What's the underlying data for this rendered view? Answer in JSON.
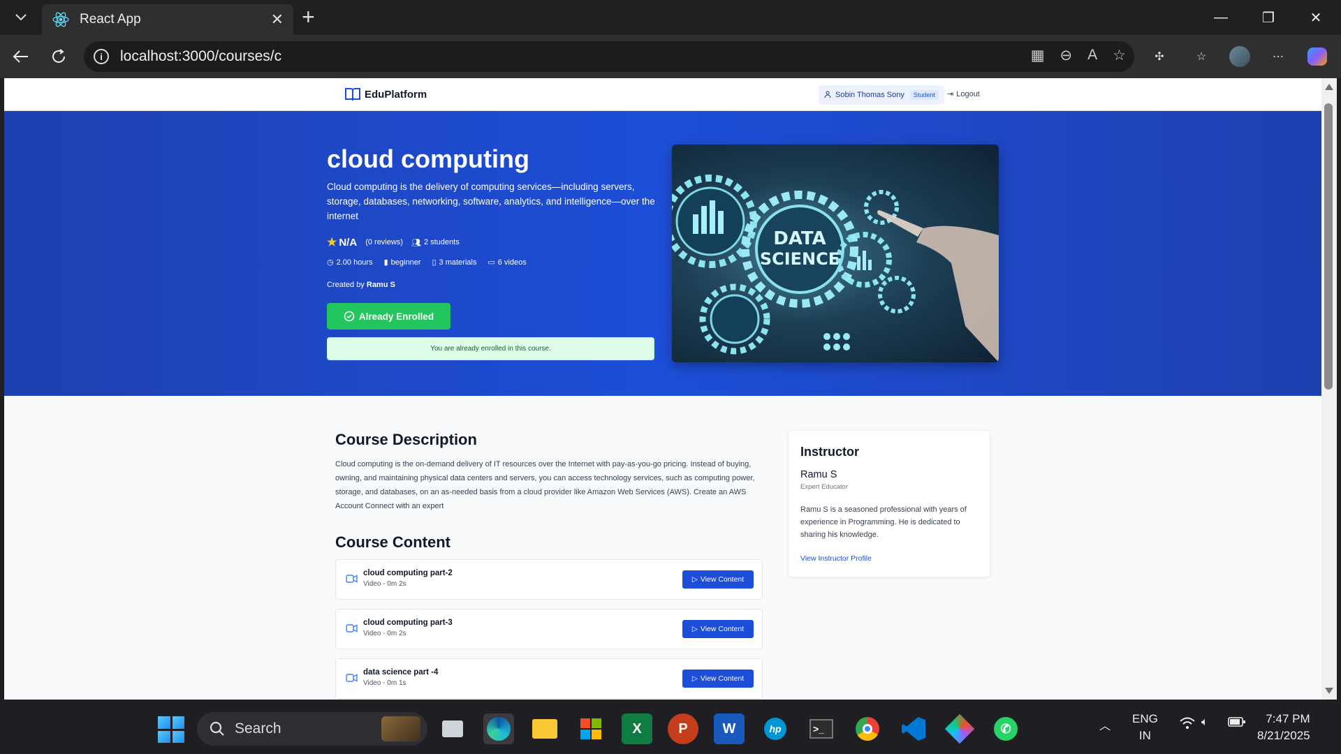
{
  "browser": {
    "tab_title": "React App",
    "url": "localhost:3000/courses/c"
  },
  "site": {
    "logo": "EduPlatform",
    "user_name": "Sobin Thomas Sony",
    "user_role": "Student",
    "logout": "Logout"
  },
  "course": {
    "title": "cloud computing",
    "short_description": "Cloud computing is the delivery of computing services—including servers, storage, databases, networking, software, analytics, and intelligence—over the internet",
    "rating": "N/A",
    "reviews": "(0 reviews)",
    "students": "2 students",
    "hours": "2.00 hours",
    "level": "beginner",
    "materials": "3 materials",
    "videos": "6 videos",
    "created_by_label": "Created by",
    "created_by": "Ramu S",
    "enroll_button": "Already Enrolled",
    "enroll_note": "You are already enrolled in this course.",
    "image_text_1": "DATA",
    "image_text_2": "SCIENCE"
  },
  "description_section": {
    "title": "Course Description",
    "text": "Cloud computing is the on-demand delivery of IT resources over the Internet with pay-as-you-go pricing. Instead of buying, owning, and maintaining physical data centers and servers, you can access technology services, such as computing power, storage, and databases, on an as-needed basis from a cloud provider like Amazon Web Services (AWS). Create an AWS Account Connect with an expert"
  },
  "content_section": {
    "title": "Course Content",
    "items": [
      {
        "title": "cloud computing part-2",
        "meta": "Video - 0m 2s",
        "button": "View Content"
      },
      {
        "title": "cloud computing part-3",
        "meta": "Video - 0m 2s",
        "button": "View Content"
      },
      {
        "title": "data science part -4",
        "meta": "Video - 0m 1s",
        "button": "View Content"
      }
    ]
  },
  "instructor": {
    "title": "Instructor",
    "name": "Ramu S",
    "role": "Expert Educator",
    "bio": "Ramu S is a seasoned professional with years of experience in Programming. He is dedicated to sharing his knowledge.",
    "link": "View Instructor Profile"
  },
  "taskbar": {
    "search": "Search",
    "lang_1": "ENG",
    "lang_2": "IN",
    "time": "7:47 PM",
    "date": "8/21/2025"
  },
  "colors": {
    "hero_bg": "#1d4ed8",
    "enrolled_green": "#22c55e",
    "primary_button": "#1d4ed8"
  }
}
